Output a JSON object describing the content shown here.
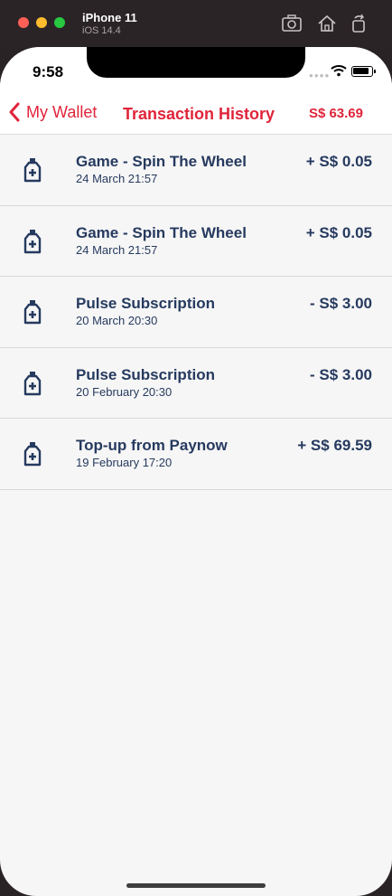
{
  "simulator": {
    "device_name": "iPhone 11",
    "os_version": "iOS 14.4"
  },
  "status_bar": {
    "time": "9:58"
  },
  "nav": {
    "back_label": "My Wallet",
    "title": "Transaction History",
    "balance": "S$ 63.69"
  },
  "colors": {
    "accent": "#e0243a",
    "text_navy": "#263a5f",
    "background": "#f6f6f6"
  },
  "transactions": [
    {
      "title": "Game - Spin The Wheel",
      "date": "24 March 21:57",
      "amount": "+ S$ 0.05",
      "icon": "medicine-bottle-icon"
    },
    {
      "title": "Game - Spin The Wheel",
      "date": "24 March 21:57",
      "amount": "+ S$ 0.05",
      "icon": "medicine-bottle-icon"
    },
    {
      "title": "Pulse Subscription",
      "date": "20 March 20:30",
      "amount": "- S$ 3.00",
      "icon": "medicine-bottle-icon"
    },
    {
      "title": "Pulse Subscription",
      "date": "20 February 20:30",
      "amount": "- S$ 3.00",
      "icon": "medicine-bottle-icon"
    },
    {
      "title": "Top-up from Paynow",
      "date": "19 February 17:20",
      "amount": "+ S$ 69.59",
      "icon": "medicine-bottle-icon"
    }
  ]
}
